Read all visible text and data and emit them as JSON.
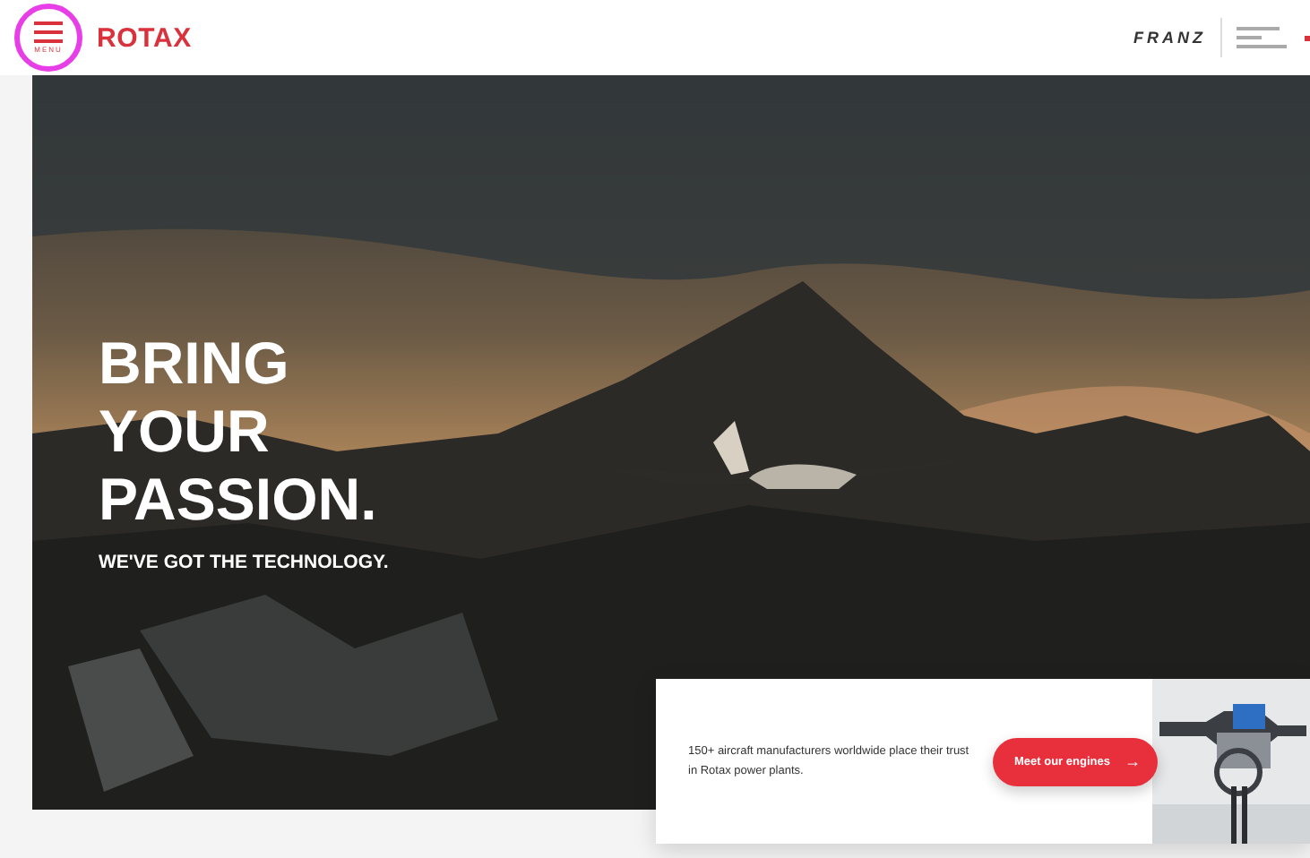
{
  "header": {
    "menu_label": "MENU",
    "brand": "ROTAX",
    "partner_logo": "FRANZ"
  },
  "hero": {
    "headline": [
      "BRING",
      "YOUR",
      "PASSION."
    ],
    "subheadline": "WE'VE GOT THE TECHNOLOGY."
  },
  "card": {
    "text": "150+ aircraft manufacturers worldwide place their trust in Rotax power plants.",
    "button": "Meet our engines",
    "button_icon": "→"
  }
}
